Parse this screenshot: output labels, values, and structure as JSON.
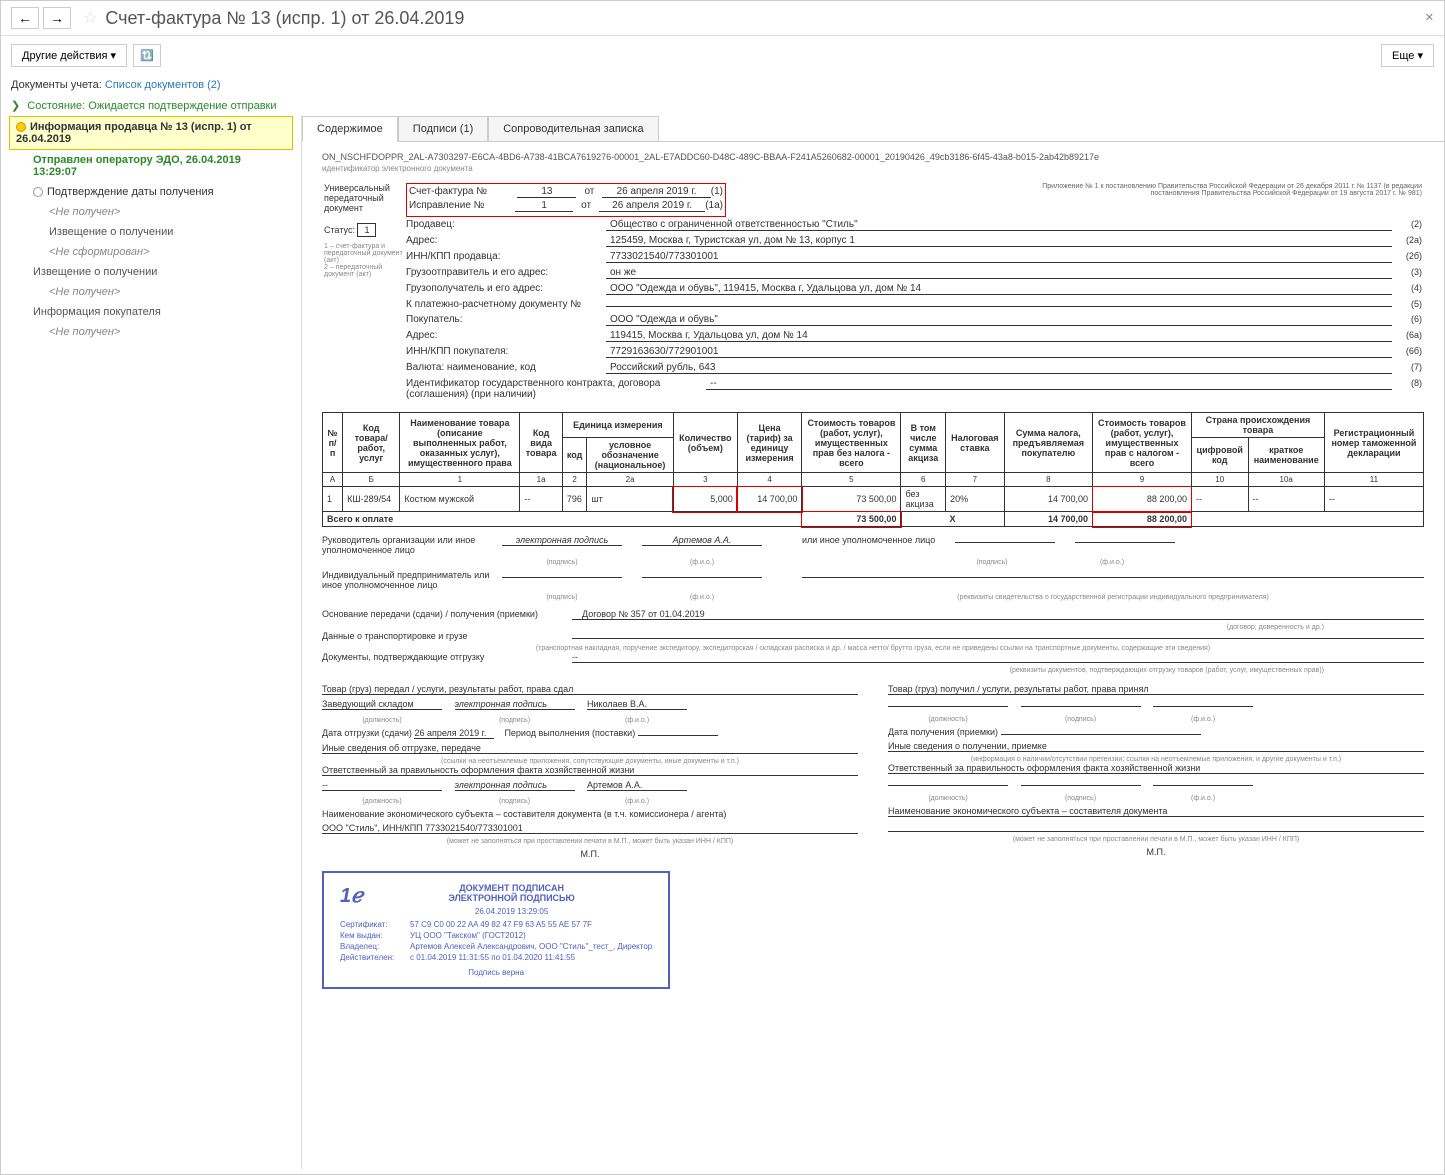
{
  "window": {
    "title": "Счет-фактура № 13 (испр. 1) от 26.04.2019"
  },
  "toolbar": {
    "other_actions": "Другие действия",
    "more": "Еще"
  },
  "subheader": {
    "docs_label": "Документы учета:",
    "docs_link": "Список документов (2)",
    "status_label": "Состояние:",
    "status_value": "Ожидается подтверждение отправки"
  },
  "tree": {
    "item0": "Информация продавца № 13 (испр. 1) от 26.04.2019",
    "item1": "Отправлен оператору ЭДО, 26.04.2019 13:29:07",
    "item2": "Подтверждение даты получения",
    "not_received": "<Не получен>",
    "item3": "Извещение о получении",
    "not_formed": "<Не сформирован>",
    "item4": "Извещение о получении",
    "item5": "Информация покупателя"
  },
  "tabs": {
    "content": "Содержимое",
    "signatures": "Подписи (1)",
    "note": "Сопроводительная записка"
  },
  "doc_id": "ON_NSCHFDOPPR_2AL-A7303297-E6CA-4BD6-A738-41BCA7619276-00001_2AL-E7ADDC60-D48C-489C-BBAA-F241A5260682-00001_20190426_49cb3186-6f45-43a8-b015-2ab42b89217e",
  "doc_id_sub": "идентификатор электронного документа",
  "appendix_note": "Приложение № 1 к постановлению Правительства Российской Федерации от 26 декабря 2011 г. № 1137 (в редакции постановления Правительства Российской Федерации от 19 августа 2017 г. № 981)",
  "header": {
    "upd_label": "Универсальный передаточный документ",
    "status_label": "Статус:",
    "status_val": "1",
    "status_note1": "1 – счет-фактура и передаточный документ (акт)",
    "status_note2": "2 – передаточный документ (акт)",
    "invoice_label": "Счет-фактура №",
    "invoice_num": "13",
    "from": "от",
    "invoice_date": "26 апреля 2019 г.",
    "code1": "(1)",
    "correction_label": "Исправление №",
    "correction_num": "1",
    "correction_date": "26 апреля 2019 г.",
    "code1a": "(1а)",
    "seller_label": "Продавец:",
    "seller": "Общество с ограниченной ответственностью \"Стиль\"",
    "code2": "(2)",
    "address_label": "Адрес:",
    "seller_address": "125459, Москва г, Туристская ул, дом № 13, корпус 1",
    "code2a": "(2а)",
    "inn_seller_label": "ИНН/КПП продавца:",
    "inn_seller": "7733021540/773301001",
    "code2b": "(2б)",
    "shipper_label": "Грузоотправитель и его адрес:",
    "shipper": "он же",
    "code3": "(3)",
    "consignee_label": "Грузополучатель и его адрес:",
    "consignee": "ООО \"Одежда и обувь\", 119415, Москва г, Удальцова ул, дом № 14",
    "code4": "(4)",
    "payment_label": "К платежно-расчетному документу №",
    "code5": "(5)",
    "buyer_label": "Покупатель:",
    "buyer": "ООО \"Одежда и обувь\"",
    "code6": "(6)",
    "buyer_address": "119415, Москва г, Удальцова ул, дом № 14",
    "code6a": "(6а)",
    "inn_buyer_label": "ИНН/КПП покупателя:",
    "inn_buyer": "7729163630/772901001",
    "code6b": "(6б)",
    "currency_label": "Валюта: наименование, код",
    "currency": "Российский рубль, 643",
    "code7": "(7)",
    "contract_label": "Идентификатор государственного контракта, договора (соглашения) (при наличии)",
    "contract": "--",
    "code8": "(8)"
  },
  "table": {
    "headers": {
      "npp": "№ п/п",
      "code_goods": "Код товара/ работ, услуг",
      "name": "Наименование товара (описание выполненных работ, оказанных услуг), имущественного права",
      "type_code": "Код вида товара",
      "unit": "Единица измерения",
      "unit_code": "код",
      "unit_name": "условное обозначение (национальное)",
      "qty": "Количество (объем)",
      "price": "Цена (тариф) за единицу измерения",
      "cost_no_tax": "Стоимость товаров (работ, услуг), имущественных прав без налога - всего",
      "excise": "В том числе сумма акциза",
      "tax_rate": "Налоговая ставка",
      "tax_sum": "Сумма налога, предъявляемая покупателю",
      "cost_with_tax": "Стоимость товаров (работ, услуг), имущественных прав с налогом - всего",
      "country": "Страна происхождения товара",
      "country_code": "цифровой код",
      "country_name": "краткое наименование",
      "decl_num": "Регистрационный номер таможенной декларации"
    },
    "col_nums": [
      "А",
      "Б",
      "1",
      "1а",
      "2",
      "2а",
      "3",
      "4",
      "5",
      "6",
      "7",
      "8",
      "9",
      "10",
      "10а",
      "11"
    ],
    "row": {
      "n": "1",
      "code": "КШ-289/54",
      "name": "Костюм мужской",
      "type": "--",
      "unit_code": "796",
      "unit_name": "шт",
      "qty": "5,000",
      "price": "14 700,00",
      "cost": "73 500,00",
      "excise": "без акциза",
      "rate": "20%",
      "tax": "14 700,00",
      "total": "88 200,00",
      "cc": "--",
      "cn": "--",
      "decl": "--"
    },
    "total_label": "Всего к оплате",
    "total_cost": "73 500,00",
    "total_x": "Х",
    "total_tax": "14 700,00",
    "total_with_tax": "88 200,00"
  },
  "sig": {
    "head_label": "Руководитель организации или иное уполномоченное лицо",
    "esign": "электронная подпись",
    "sign_sub": "(подпись)",
    "fio_sub": "(ф.и.о.)",
    "head_name": "Артемов А.А.",
    "other_label": "или иное уполномоченное лицо",
    "entrepreneur_label": "Индивидуальный предприниматель или иное уполномоченное лицо",
    "entrepreneur_note": "(реквизиты свидетельства о государственной регистрации индивидуального предпринимателя)",
    "basis_label": "Основание передачи (сдачи) / получения (приемки)",
    "basis_val": "Договор № 357 от 01.04.2019",
    "basis_sub": "(договор; доверенность и др.)",
    "transport_label": "Данные о транспортировке и грузе",
    "transport_sub": "(транспортная накладная, поручение экспедитору, экспедиторская / складская расписка и др. / масса нетто/ брутто груза, если не приведены ссылки на транспортные документы, содержащие эти сведения)",
    "shipping_docs_label": "Документы, подтверждающие отгрузку",
    "shipping_docs_val": "--",
    "shipping_docs_sub": "(реквизиты документов, подтверждающих отгрузку товаров (работ, услуг, имущественных прав))"
  },
  "transfer": {
    "left_title": "Товар (груз) передал / услуги, результаты работ, права сдал",
    "left_who": "Заведующий складом",
    "left_name": "Николаев В.А.",
    "position_sub": "(должность)",
    "ship_date_label": "Дата отгрузки (сдачи)",
    "ship_date": "26 апреля 2019 г.",
    "period_label": "Период выполнения (поставки)",
    "other_info_left": "Иные сведения об отгрузке, передаче",
    "other_sub_left": "(ссылки на неотъемлемые приложения, сопутствующие документы, иные документы и т.п.)",
    "responsible_left": "Ответственный за правильность оформления факта хозяйственной жизни",
    "resp_left_val": "--",
    "resp_name": "Артемов А.А.",
    "entity_left_label": "Наименование экономического субъекта – составителя документа (в т.ч. комиссионера / агента)",
    "entity_left": "ООО \"Стиль\", ИНН/КПП 7733021540/773301001",
    "mp": "М.П.",
    "mp_note": "(может не заполняться при проставлении печати в М.П., может быть указан ИНН / КПП)",
    "right_title": "Товар (груз) получил / услуги, результаты работ, права принял",
    "recv_date_label": "Дата получения (приемки)",
    "other_info_right": "Иные сведения о получении, приемке",
    "other_sub_right": "(информация о наличии/отсутствии претензии; ссылки на неотъемлемые приложения, и другие документы и т.п.)",
    "responsible_right": "Ответственный за правильность оформления факта хозяйственной жизни",
    "entity_right_label": "Наименование экономического субъекта – составителя документа"
  },
  "stamp": {
    "title1": "ДОКУМЕНТ ПОДПИСАН",
    "title2": "ЭЛЕКТРОННОЙ ПОДПИСЬЮ",
    "date": "26.04.2019 13:29:05",
    "cert_k": "Сертификат:",
    "cert_v": "57 C9 C0 00 22 AA 49 82 47 F9 63 A5 55 AE 57 7F",
    "issued_k": "Кем выдан:",
    "issued_v": "УЦ ООО \"Такском\" (ГОСТ2012)",
    "owner_k": "Владелец:",
    "owner_v": "Артемов Алексей Александрович, ООО \"Стиль\"_тест_, Директор",
    "valid_k": "Действителен:",
    "valid_v": "с 01.04.2019 11:31:55 по 01.04.2020 11:41:55",
    "verified": "Подпись верна"
  }
}
